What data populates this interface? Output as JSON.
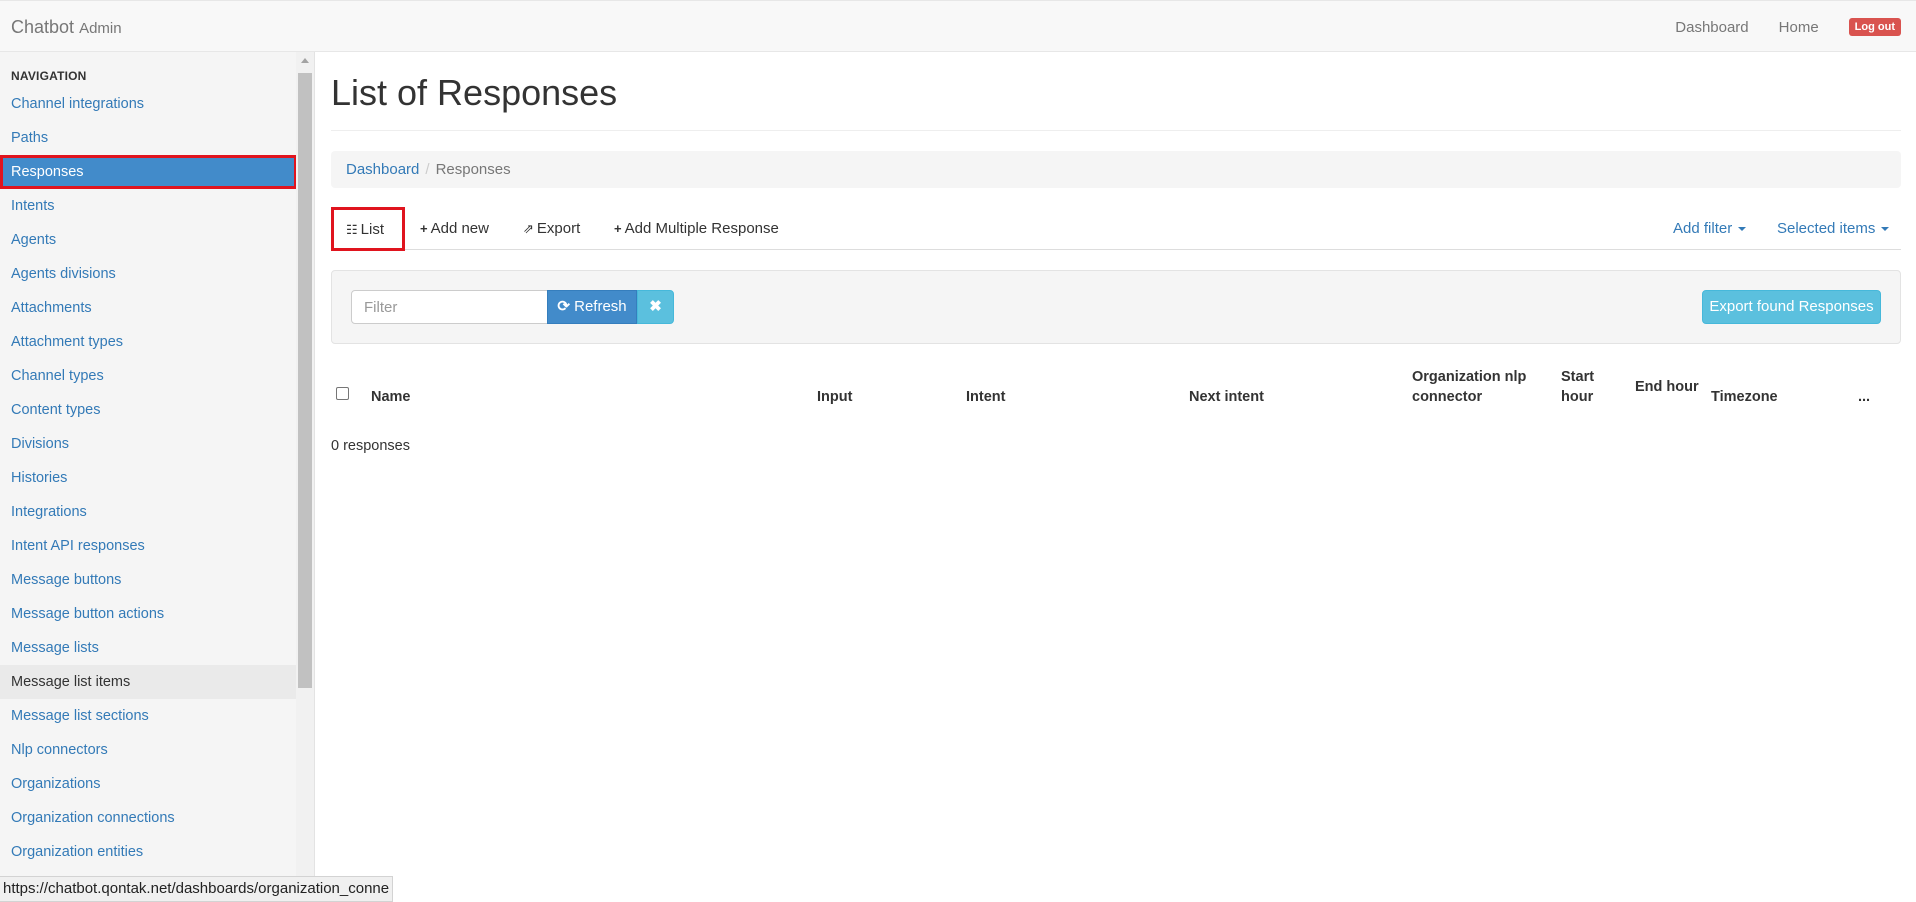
{
  "navbar": {
    "brand": "Chatbot",
    "brand_sub": "Admin",
    "links": [
      "Dashboard",
      "Home"
    ],
    "logout": "Log out"
  },
  "sidebar": {
    "header": "NAVIGATION",
    "items": [
      "Channel integrations",
      "Paths",
      "Responses",
      "Intents",
      "Agents",
      "Agents divisions",
      "Attachments",
      "Attachment types",
      "Channel types",
      "Content types",
      "Divisions",
      "Histories",
      "Integrations",
      "Intent API responses",
      "Message buttons",
      "Message button actions",
      "Message lists",
      "Message list items",
      "Message list sections",
      "Nlp connectors",
      "Organizations",
      "Organization connections",
      "Organization entities"
    ],
    "active_item": "Responses",
    "hovered_item": "Message list items"
  },
  "main": {
    "title": "List of Responses",
    "breadcrumb": {
      "home": "Dashboard",
      "current": "Responses"
    },
    "tabs": {
      "list": "List",
      "add_new": "Add new",
      "export": "Export",
      "add_multiple": "Add Multiple Response",
      "add_filter": "Add filter",
      "selected_items": "Selected items"
    },
    "filter": {
      "placeholder": "Filter",
      "value": "",
      "refresh": "Refresh",
      "export_found": "Export found Responses"
    },
    "table": {
      "columns": [
        "Name",
        "Input",
        "Intent",
        "Next intent",
        "Organization nlp connector",
        "Start hour",
        "End hour",
        "Timezone",
        "..."
      ],
      "rows": []
    },
    "count_text": "0 responses"
  },
  "status_bar": {
    "url": "https://chatbot.qontak.net/dashboards/organization_conne"
  },
  "colors": {
    "link": "#337ab7",
    "active_bg": "#428bca",
    "highlight_outline": "#e0141e",
    "info_button": "#5bc0de",
    "danger": "#d9534f"
  }
}
